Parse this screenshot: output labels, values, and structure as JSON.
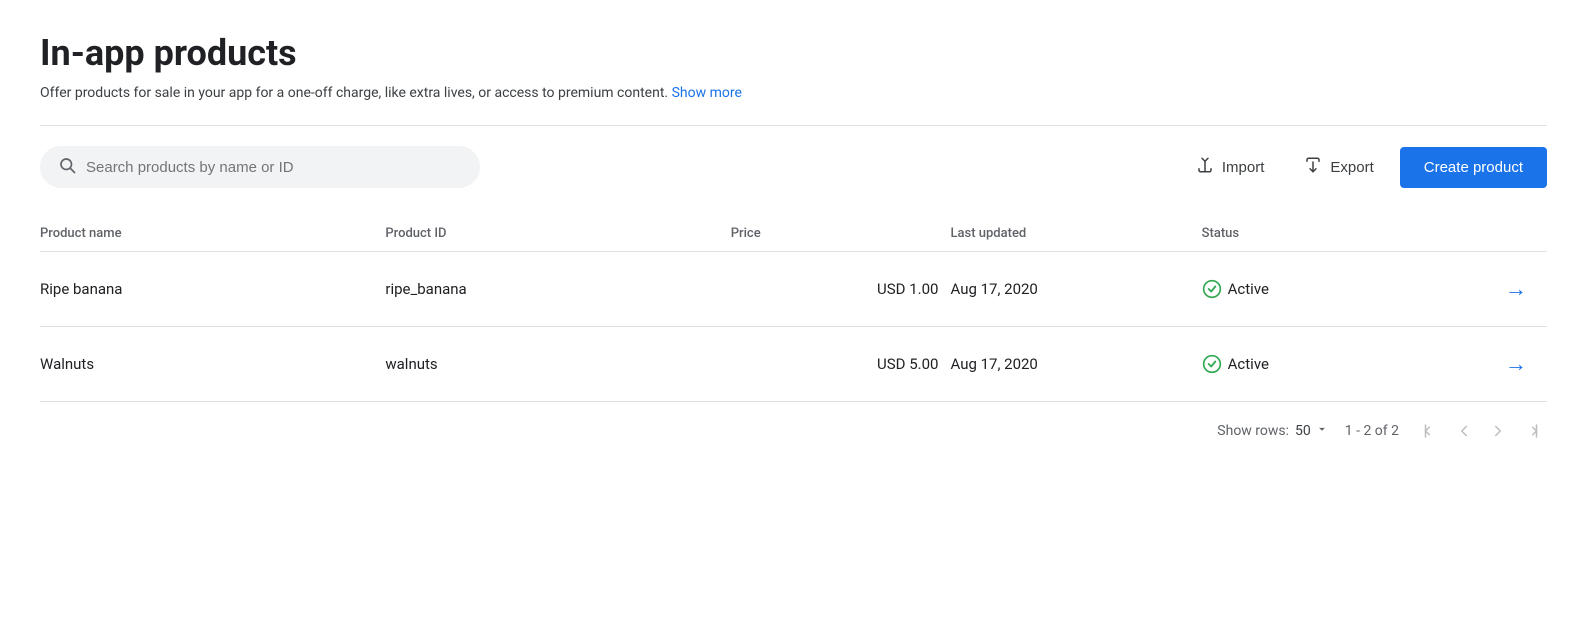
{
  "page": {
    "title": "In-app products",
    "description": "Offer products for sale in your app for a one-off charge, like extra lives, or access to premium content.",
    "show_more_label": "Show more"
  },
  "toolbar": {
    "search_placeholder": "Search products by name or ID",
    "import_label": "Import",
    "export_label": "Export",
    "create_label": "Create product"
  },
  "table": {
    "columns": [
      {
        "key": "name",
        "label": "Product name"
      },
      {
        "key": "id",
        "label": "Product ID"
      },
      {
        "key": "price",
        "label": "Price"
      },
      {
        "key": "updated",
        "label": "Last updated"
      },
      {
        "key": "status",
        "label": "Status"
      },
      {
        "key": "arrow",
        "label": ""
      }
    ],
    "rows": [
      {
        "name": "Ripe banana",
        "product_id": "ripe_banana",
        "price": "USD 1.00",
        "last_updated": "Aug 17, 2020",
        "status": "Active",
        "arrow": "→"
      },
      {
        "name": "Walnuts",
        "product_id": "walnuts",
        "price": "USD 5.00",
        "last_updated": "Aug 17, 2020",
        "status": "Active",
        "arrow": "→"
      }
    ]
  },
  "footer": {
    "show_rows_label": "Show rows:",
    "rows_value": "50",
    "pagination_info": "1 - 2 of 2"
  },
  "colors": {
    "accent": "#1a73e8",
    "active_green": "#34a853"
  }
}
